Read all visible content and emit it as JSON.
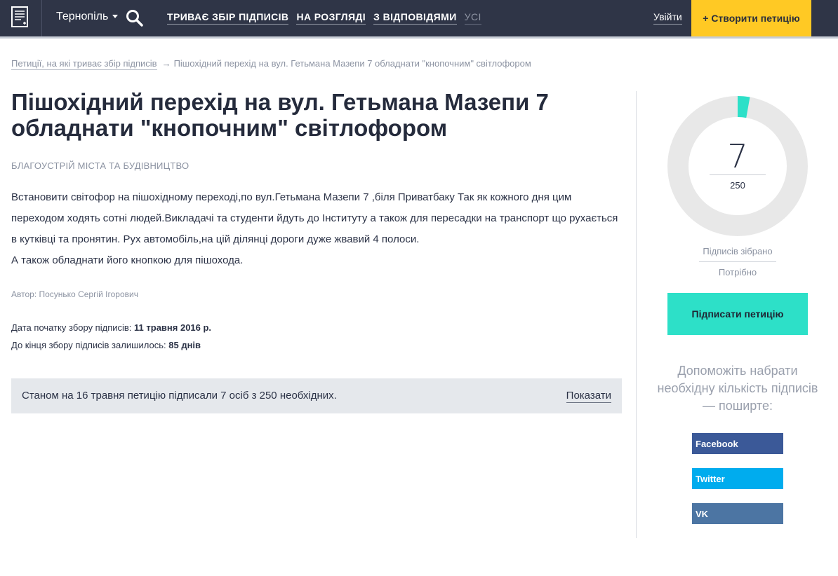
{
  "header": {
    "city": "Тернопіль",
    "nav": [
      {
        "label": "ТРИВАЄ ЗБІР ПІДПИСІВ"
      },
      {
        "label": "НА РОЗГЛЯДІ"
      },
      {
        "label": "З ВІДПОВІДЯМИ"
      },
      {
        "label": "УСІ"
      }
    ],
    "login": "Увійти",
    "create": "+ Створити петицію",
    "colors": {
      "bg": "#2f3547",
      "accent": "#ffc924"
    }
  },
  "breadcrumb": {
    "link": "Петиції, на які триває збір підписів",
    "separator": "→",
    "current": "Пішохідний перехід на вул. Гетьмана Мазепи 7 обладнати \"кнопочним\" світлофором"
  },
  "petition": {
    "title": "Пішохідний перехід на вул. Гетьмана Мазепи 7 обладнати \"кнопочним\" світлофором",
    "category": "БЛАГОУСТРІЙ МІСТА ТА БУДІВНИЦТВО",
    "body": [
      "Встановити світофор на пішохідному переході,по вул.Гетьмана Мазепи 7 ,біля Приватбаку Так як кожного дня цим переходом ходять сотні людей.Викладачі та студенти йдуть до Інституту а також для пересадки на транспорт що рухається в кутківці та пронятин.  Рух автомобіль,на цій ділянці дороги дуже жвавий 4 полоси.",
      "А також обладнати його кнопкою для пішохода."
    ],
    "author": "Автор: Посунько Сергій Ігорович",
    "start_label": "Дата початку збору підписів: ",
    "start_value": "11 травня 2016 р.",
    "remaining_label": "До кінця збору підписів залишилось: ",
    "remaining_value": "85 днів",
    "status_text": "Станом на 16 травня петицію підписали 7 осіб з 250 необхідних.",
    "show_label": "Показати"
  },
  "sidebar": {
    "signatures": 7,
    "signatures_text": "7",
    "goal": 250,
    "goal_text": "250",
    "collected_label": "Підписів зібрано",
    "needed_label": "Потрібно",
    "sign_button": "Підписати петицію",
    "share_text": "Допоможіть набрати необхідну кількість підписів — поширте:",
    "social": [
      {
        "label": "Facebook",
        "color": "#3b5998"
      },
      {
        "label": "Twitter",
        "color": "#00acee"
      },
      {
        "label": "VK",
        "color": "#4c75a3"
      }
    ],
    "progress_color": "#2de0c8",
    "track_color": "#e8e8e8"
  }
}
